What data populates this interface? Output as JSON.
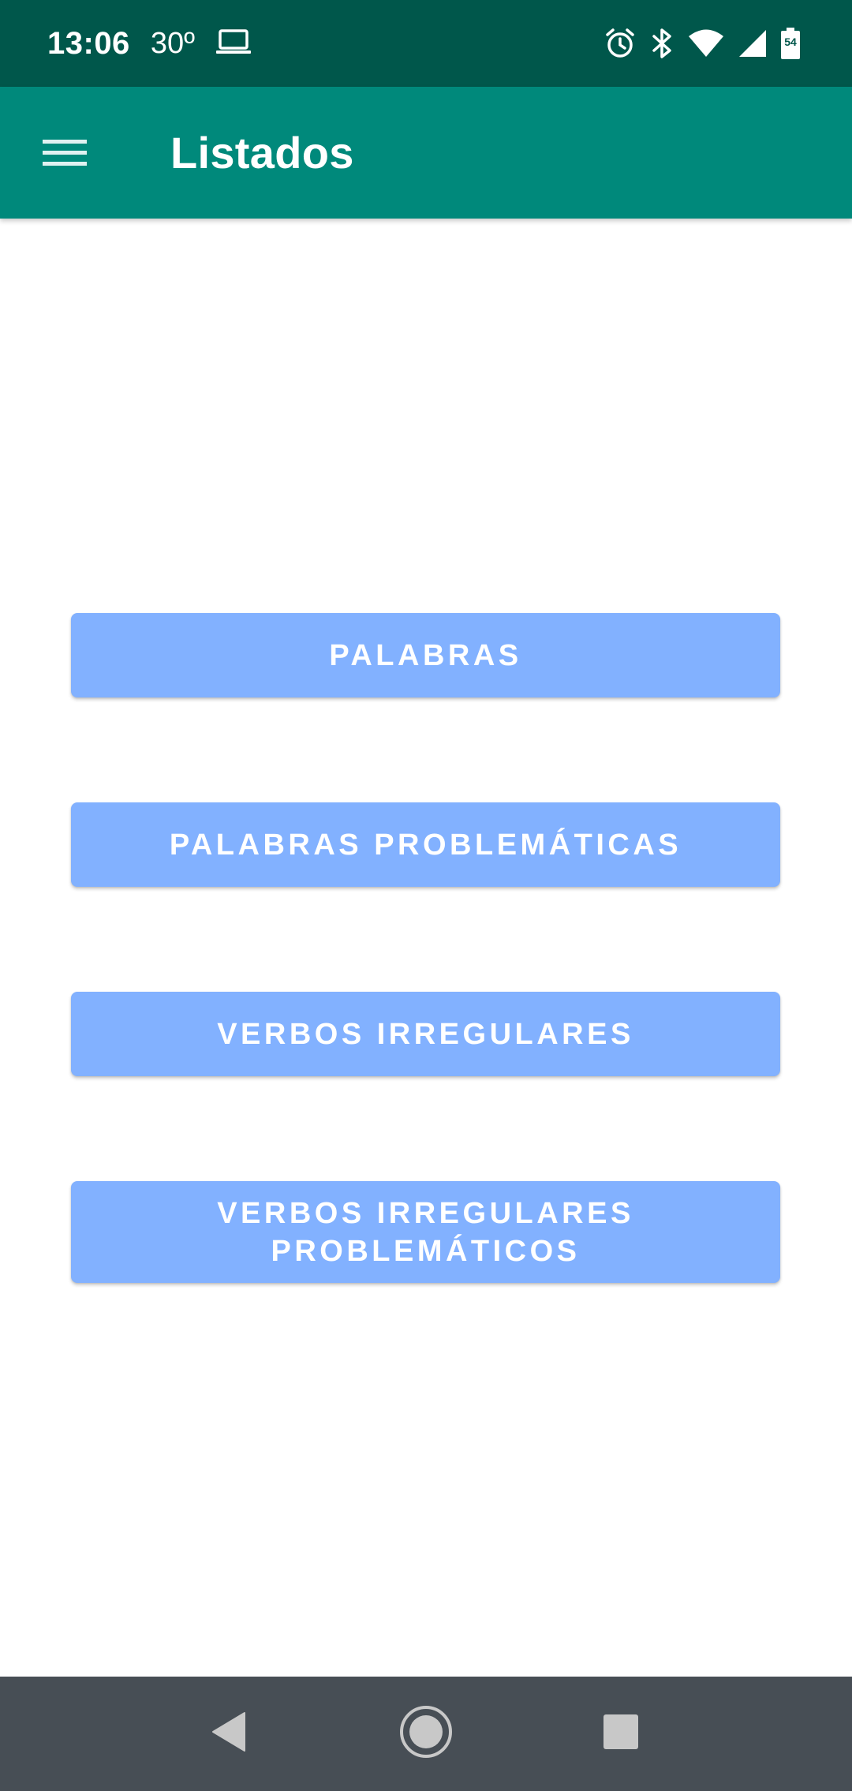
{
  "status_bar": {
    "time": "13:06",
    "temperature": "30º",
    "battery_level": "54"
  },
  "app_bar": {
    "title": "Listados",
    "menu_icon": "hamburger-menu-icon"
  },
  "buttons": [
    {
      "label": "PALABRAS"
    },
    {
      "label": "PALABRAS PROBLEMÁTICAS"
    },
    {
      "label": "VERBOS IRREGULARES"
    },
    {
      "label_line1": "VERBOS IRREGULARES",
      "label_line2": "PROBLEMÁTICOS"
    }
  ],
  "nav_bar": {
    "back_icon": "back-triangle-icon",
    "home_icon": "home-circle-icon",
    "recents_icon": "recents-square-icon"
  },
  "colors": {
    "status_bar": "#00574b",
    "app_bar": "#00897b",
    "button": "#82b1ff",
    "nav_bar": "#474e55"
  }
}
